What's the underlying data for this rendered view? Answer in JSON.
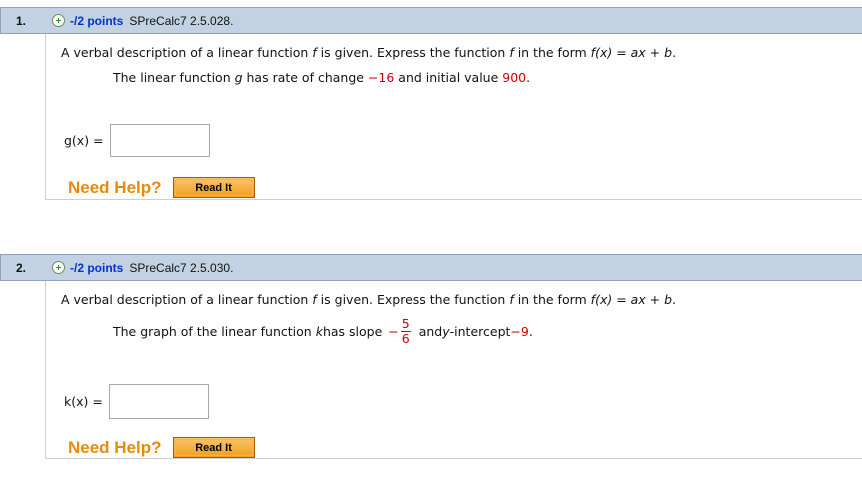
{
  "questions": [
    {
      "number": "1.",
      "points": "-/2 points",
      "source": "SPreCalc7 2.5.028.",
      "prompt_a": "A verbal description of a linear function ",
      "prompt_f1": "f",
      "prompt_b": " is given. Express the function ",
      "prompt_f2": "f",
      "prompt_c": " in the form ",
      "prompt_form": "f(x) = ax + b",
      "prompt_end": ".",
      "detail_a": "The linear function ",
      "detail_var": "g",
      "detail_b": " has rate of change ",
      "detail_rate": "−16",
      "detail_c": " and initial value ",
      "detail_initial": "900",
      "detail_end": ".",
      "answer_label": "g(x) =",
      "answer_value": "",
      "need_help": "Need Help?",
      "read_it": "Read It"
    },
    {
      "number": "2.",
      "points": "-/2 points",
      "source": "SPreCalc7 2.5.030.",
      "prompt_a": "A verbal description of a linear function ",
      "prompt_f1": "f",
      "prompt_b": " is given. Express the function ",
      "prompt_f2": "f",
      "prompt_c": " in the form ",
      "prompt_form": "f(x) = ax + b",
      "prompt_end": ".",
      "detail_a": "The graph of the linear function ",
      "detail_var": "k",
      "detail_b": " has slope ",
      "slope_sign": "−",
      "slope_num": "5",
      "slope_den": "6",
      "detail_c": " and ",
      "detail_y": "y",
      "detail_d": "-intercept ",
      "detail_intercept": "−9",
      "detail_end": ".",
      "answer_label": "k(x) =",
      "answer_value": "",
      "need_help": "Need Help?",
      "read_it": "Read It"
    }
  ],
  "colors": {
    "header_bg": "#c3d2e2",
    "points_blue": "#0033cc",
    "value_red": "#cc0000",
    "help_orange": "#e88a0c",
    "button_orange": "#f0a01e"
  },
  "icons": {
    "expand": "plus-circle-icon"
  }
}
